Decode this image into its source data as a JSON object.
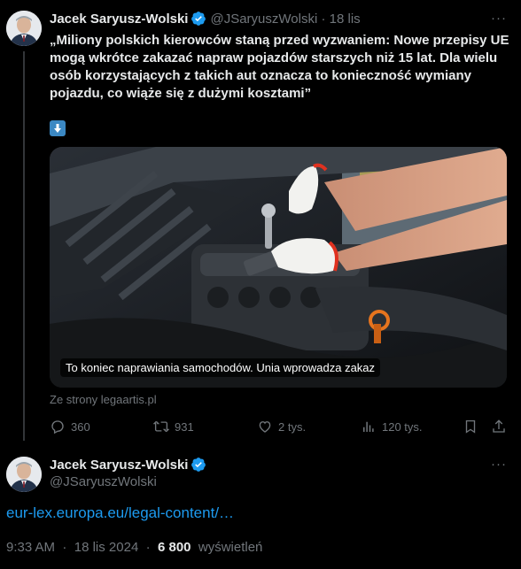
{
  "tweet": {
    "author_name": "Jacek Saryusz-Wolski",
    "handle": "@JSaryuszWolski",
    "date": "18 lis",
    "more": "···",
    "text": "„Miliony polskich kierowców staną przed wyzwaniem: Nowe przepisy UE mogą wkrótce zakazać napraw pojazdów starszych niż 15 lat. Dla wielu osób korzystających z takich aut oznacza to konieczność wymiany pojazdu, co wiąże się z dużymi kosztami”",
    "emoji": "down-arrow-emoji",
    "card": {
      "caption": "To koniec naprawiania samochodów. Unia wprowadza zakaz",
      "source": "Ze strony legaartis.pl"
    },
    "actions": {
      "replies": "360",
      "reposts": "931",
      "likes": "2 tys.",
      "views": "120 tys."
    }
  },
  "reply": {
    "author_name": "Jacek Saryusz-Wolski",
    "handle": "@JSaryuszWolski",
    "more": "···",
    "link": "eur-lex.europa.eu/legal-content/…",
    "time": "9:33 AM",
    "date": "18 lis 2024",
    "views_count": "6 800",
    "views_label": "wyświetleń",
    "separator": "·"
  },
  "colors": {
    "background": "#000000",
    "text": "#e7e9ea",
    "muted": "#71767b",
    "link": "#1d9bf0",
    "verified": "#1d9bf0"
  },
  "icons": [
    "verified-badge-icon",
    "reply-icon",
    "repost-icon",
    "like-icon",
    "views-icon",
    "bookmark-icon",
    "share-icon"
  ]
}
